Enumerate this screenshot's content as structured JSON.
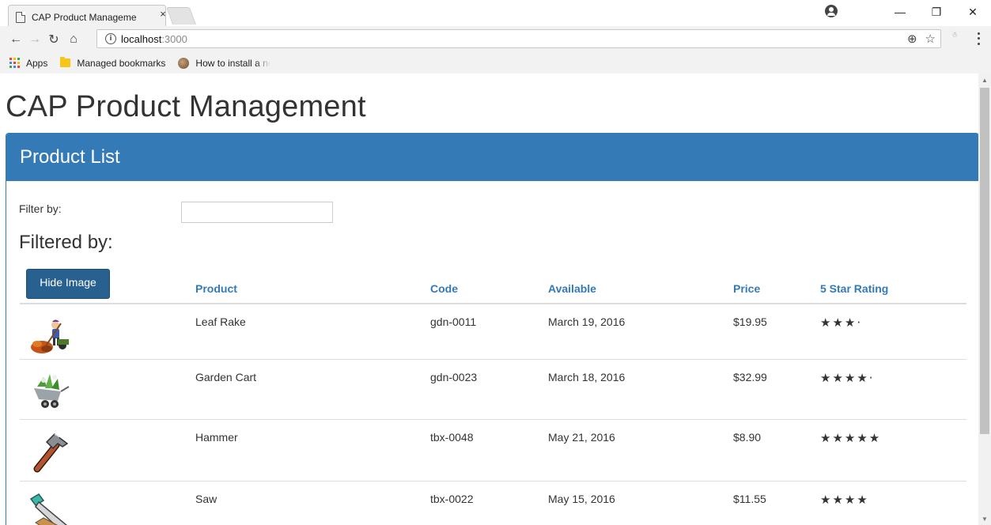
{
  "browser": {
    "tab_title": "CAP Product Manageme",
    "tab_close": "×",
    "url_host": "localhost",
    "url_port": ":3000",
    "bookmarks": [
      {
        "label": "Apps"
      },
      {
        "label": "Managed bookmarks"
      },
      {
        "label": "How to install a new"
      }
    ]
  },
  "page": {
    "title": "CAP Product Management",
    "panel_title": "Product List",
    "filter_label": "Filter by:",
    "filter_value": "",
    "filtered_by": "Filtered by:",
    "hide_image_label": "Hide Image"
  },
  "table": {
    "headers": [
      "Product",
      "Code",
      "Available",
      "Price",
      "5 Star Rating"
    ],
    "rows": [
      {
        "name": "Leaf Rake",
        "code": "gdn-0011",
        "available": "March 19, 2016",
        "price": "$19.95",
        "rating": 3.2,
        "stars": "★★★·",
        "image": "leaf-rake"
      },
      {
        "name": "Garden Cart",
        "code": "gdn-0023",
        "available": "March 18, 2016",
        "price": "$32.99",
        "rating": 4.2,
        "stars": "★★★★·",
        "image": "garden-cart"
      },
      {
        "name": "Hammer",
        "code": "tbx-0048",
        "available": "May 21, 2016",
        "price": "$8.90",
        "rating": 4.8,
        "stars": "★★★★★",
        "image": "hammer"
      },
      {
        "name": "Saw",
        "code": "tbx-0022",
        "available": "May 15, 2016",
        "price": "$11.55",
        "rating": 3.7,
        "stars": "★★★★",
        "image": "saw"
      }
    ]
  },
  "colors": {
    "primary": "#337ab7",
    "button": "#286090"
  }
}
